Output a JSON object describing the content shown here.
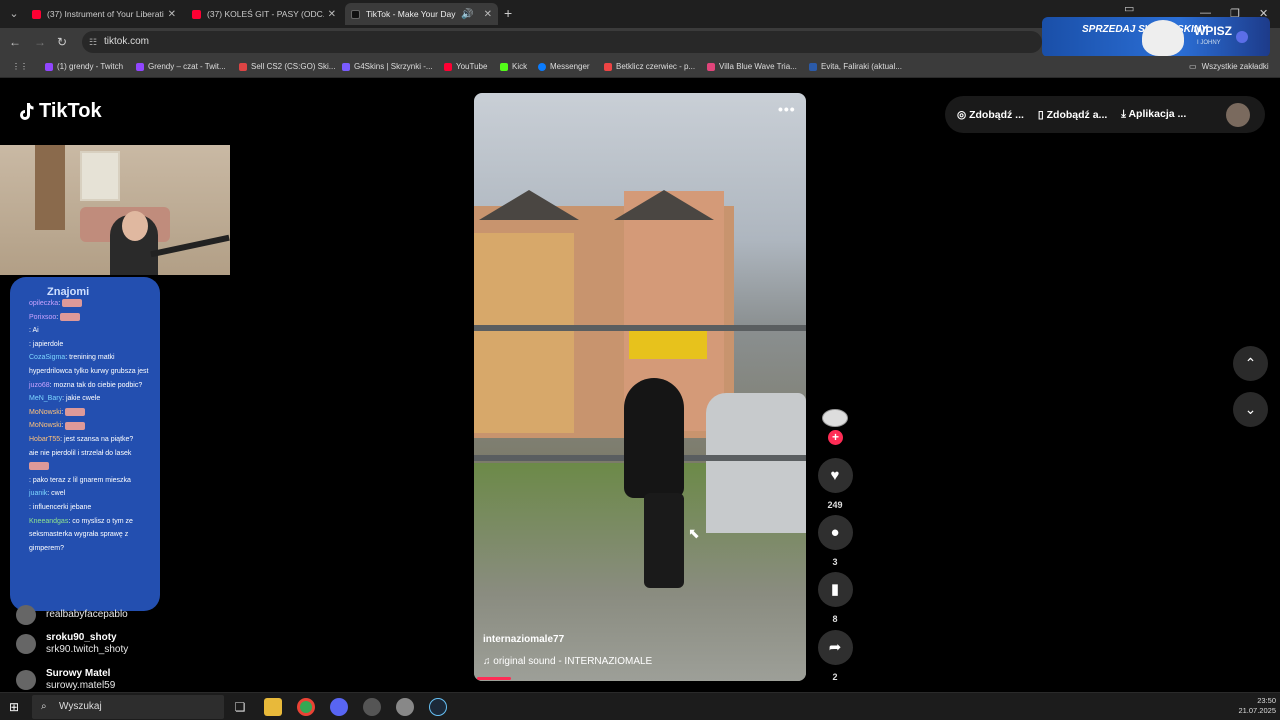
{
  "browser": {
    "tabs": [
      {
        "title": "(37) Instrument of Your Liberati",
        "favicon_color": "#ff0033",
        "active": false
      },
      {
        "title": "(37) KOLEŚ GIT - PASY (ODC. 1",
        "favicon_color": "#ff0033",
        "active": false
      },
      {
        "title": "TikTok - Make Your Day",
        "favicon_color": "#111111",
        "active": true
      }
    ],
    "url": "tiktok.com",
    "bookmarks": [
      {
        "label": "(1) grendy - Twitch",
        "color": "#9146ff"
      },
      {
        "label": "Grendy – czat - Twit...",
        "color": "#9146ff"
      },
      {
        "label": "Sell CS2 (CS:GO) Ski...",
        "color": "#d44"
      },
      {
        "label": "G4Skins | Skrzynki -...",
        "color": "#7a5cff"
      },
      {
        "label": "YouTube",
        "color": "#ff0033"
      },
      {
        "label": "Kick",
        "color": "#53fc18"
      },
      {
        "label": "Messenger",
        "color": "#0a7cff"
      },
      {
        "label": "Betklicz czerwiec - p...",
        "color": "#e44"
      },
      {
        "label": "Villa Blue Wave Tria...",
        "color": "#e0457b"
      },
      {
        "label": "Evita, Faliraki (aktual...",
        "color": "#2b5aa8"
      }
    ],
    "all_bookmarks": "Wszystkie zakładki",
    "ad": {
      "line1": "SPRZEDAJ SWOJE SKINY",
      "line2": "WPISZ",
      "line3": "I JOHNY"
    }
  },
  "tiktok": {
    "logo": "TikTok",
    "topbar": [
      "Zdobądź ...",
      "Zdobądź a...",
      "Aplikacja ..."
    ],
    "video": {
      "username": "internaziomale77",
      "sound": "original sound - INTERNAZIOMALE"
    },
    "actions": {
      "likes": "249",
      "comments": "3",
      "saves": "8",
      "shares": "2"
    },
    "sidebar": [
      {
        "name": "",
        "id": "realbabyfacepablo"
      },
      {
        "name": "sroku90_shoty",
        "id": "srk90.twitch_shoty"
      },
      {
        "name": "Surowy Matel",
        "id": "surowy.matel59"
      }
    ]
  },
  "overlay_chat": {
    "header": "Znajomi",
    "lines": [
      {
        "user": "opileczka",
        "text": ":",
        "emote": true,
        "cls": "u2"
      },
      {
        "user": "Porixsoo",
        "text": ":",
        "emote": true,
        "cls": "u2"
      },
      {
        "user": "",
        "text": ": Ai",
        "emote": false,
        "cls": "u2"
      },
      {
        "user": "",
        "text": ": japierdole",
        "emote": false,
        "cls": "u2"
      },
      {
        "user": "CozaSigma",
        "text": ": trenining matki hyperdrilowca tylko kurwy grubsza jest",
        "emote": false,
        "cls": "u1"
      },
      {
        "user": "juzo68",
        "text": ": mozna tak do ciebie podbic?",
        "emote": false,
        "cls": "u2"
      },
      {
        "user": "MeN_Bary",
        "text": ": jakie cwele",
        "emote": false,
        "cls": "u1"
      },
      {
        "user": "MoNowski",
        "text": ":",
        "emote": true,
        "cls": "u3"
      },
      {
        "user": "MoNowski",
        "text": ":",
        "emote": true,
        "cls": "u3"
      },
      {
        "user": "HobarT55",
        "text": ": jest szansa na piątke?",
        "emote": false,
        "cls": "u3"
      },
      {
        "user": "",
        "text": "aie nie pierdolil i strzelał do lasek",
        "emote": true,
        "cls": "u2"
      },
      {
        "user": "",
        "text": ": pako teraz z lil gnarem mieszka",
        "emote": false,
        "cls": "u2"
      },
      {
        "user": "juanik",
        "text": ": cwel",
        "emote": false,
        "cls": "u1"
      },
      {
        "user": "",
        "text": ": influencerki jebane",
        "emote": false,
        "cls": "u2"
      },
      {
        "user": "Kneeandgas",
        "text": ": co myslisz o tym ze seksmasterka wygrała sprawę z gimperem?",
        "emote": false,
        "cls": "u4"
      }
    ]
  },
  "taskbar": {
    "search": "Wyszukaj",
    "time": "23:50",
    "date": "21.07.2025"
  }
}
